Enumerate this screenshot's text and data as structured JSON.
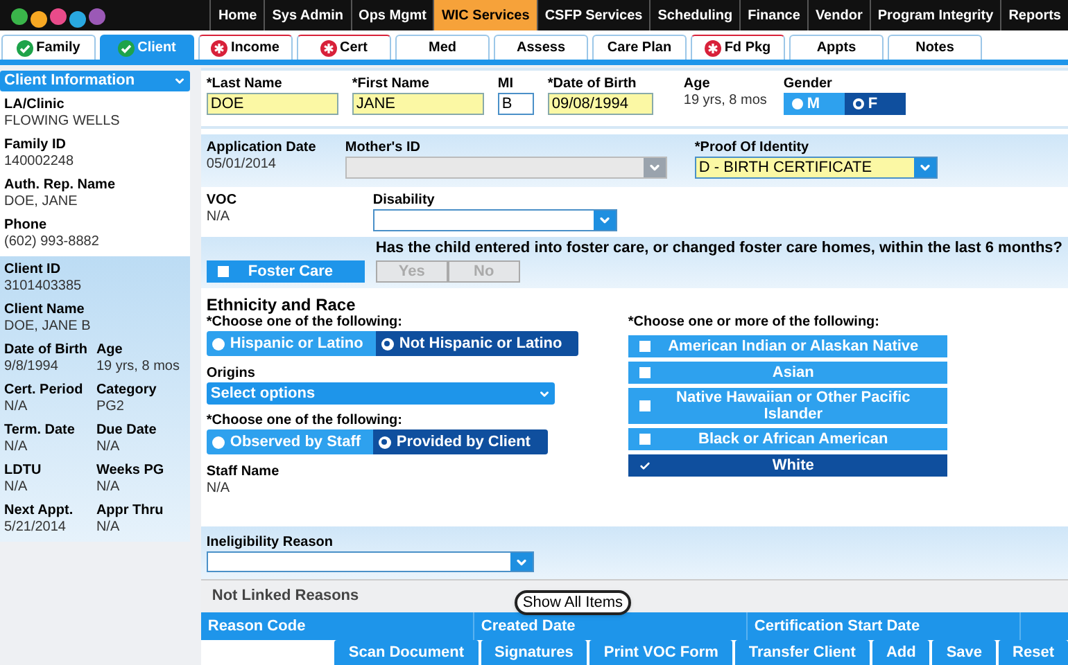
{
  "nav": [
    {
      "label": "Home",
      "selected": false
    },
    {
      "label": "Sys Admin",
      "selected": false
    },
    {
      "label": "Ops Mgmt",
      "selected": false
    },
    {
      "label": "WIC Services",
      "selected": true
    },
    {
      "label": "CSFP Services",
      "selected": false
    },
    {
      "label": "Scheduling",
      "selected": false
    },
    {
      "label": "Finance",
      "selected": false
    },
    {
      "label": "Vendor",
      "selected": false
    },
    {
      "label": "Program Integrity",
      "selected": false
    },
    {
      "label": "Reports",
      "selected": false
    }
  ],
  "tabs": [
    {
      "label": "Family",
      "kind": "complete",
      "selected": false
    },
    {
      "label": "Client",
      "kind": "complete",
      "selected": true
    },
    {
      "label": "Income",
      "kind": "required",
      "selected": false
    },
    {
      "label": "Cert",
      "kind": "required",
      "selected": false
    },
    {
      "label": "Med",
      "kind": "plain",
      "selected": false
    },
    {
      "label": "Assess",
      "kind": "plain",
      "selected": false
    },
    {
      "label": "Care Plan",
      "kind": "plain",
      "selected": false
    },
    {
      "label": "Fd Pkg",
      "kind": "required",
      "selected": false
    },
    {
      "label": "Appts",
      "kind": "plain",
      "selected": false
    },
    {
      "label": "Notes",
      "kind": "plain",
      "selected": false
    }
  ],
  "sidebar": {
    "title": "Client Information",
    "top_fields": [
      {
        "label": "LA/Clinic",
        "value": "FLOWING WELLS"
      },
      {
        "label": "Family ID",
        "value": "140002248"
      },
      {
        "label": "Auth. Rep. Name",
        "value": "DOE, JANE"
      },
      {
        "label": "Phone",
        "value": "(602) 993-8882"
      }
    ],
    "client_fields": [
      {
        "label": "Client ID",
        "value": "3101403385",
        "kind": "wide"
      },
      {
        "label": "Client Name",
        "value": "DOE, JANE B",
        "kind": "wide"
      },
      {
        "label": "Date of Birth",
        "value": "9/8/1994",
        "kind": "half"
      },
      {
        "label": "Age",
        "value": "19 yrs, 8 mos",
        "kind": "half"
      },
      {
        "label": "Cert. Period",
        "value": "N/A",
        "kind": "half"
      },
      {
        "label": "Category",
        "value": "PG2",
        "kind": "half"
      },
      {
        "label": "Term. Date",
        "value": "N/A",
        "kind": "half"
      },
      {
        "label": "Due Date",
        "value": "N/A",
        "kind": "half"
      },
      {
        "label": "LDTU",
        "value": "N/A",
        "kind": "half"
      },
      {
        "label": "Weeks PG",
        "value": "N/A",
        "kind": "half"
      },
      {
        "label": "Next Appt.",
        "value": "5/21/2014",
        "kind": "half"
      },
      {
        "label": "Appr Thru",
        "value": "N/A",
        "kind": "half"
      }
    ]
  },
  "name_row": {
    "last_name": {
      "label": "*Last Name",
      "value": "DOE"
    },
    "first_name": {
      "label": "*First Name",
      "value": "JANE"
    },
    "mi": {
      "label": "MI",
      "value": "B"
    },
    "date_of_birth": {
      "label": "*Date of Birth",
      "value": "09/08/1994"
    },
    "age": {
      "label": "Age",
      "value": "19 yrs, 8 mos"
    },
    "gender": {
      "label": "Gender",
      "options": [
        {
          "label": "M",
          "selected": false
        },
        {
          "label": "F",
          "selected": true
        }
      ]
    }
  },
  "application_date": {
    "label": "Application Date",
    "value": "05/01/2014"
  },
  "mothers_id": {
    "label": "Mother's ID",
    "disabled": true
  },
  "proof_of_identity": {
    "label": "*Proof Of Identity",
    "value": "D - BIRTH CERTIFICATE"
  },
  "voc": {
    "label": "VOC",
    "value": "N/A"
  },
  "disability": {
    "label": "Disability"
  },
  "foster_care": {
    "label": "Foster Care",
    "checked": false,
    "question": "Has the child entered into foster care, or changed foster care homes, within the last 6 months?",
    "options": [
      {
        "label": "Yes",
        "disabled": true
      },
      {
        "label": "No",
        "disabled": true
      }
    ]
  },
  "ethnicity": {
    "title": "Ethnicity and Race",
    "prompt": "*Choose one of the following:",
    "options": [
      {
        "label": "Hispanic or Latino",
        "selected": false
      },
      {
        "label": "Not Hispanic or Latino",
        "selected": true
      }
    ],
    "origins_label": "Origins",
    "origins_placeholder": "Select options",
    "source_prompt": "*Choose one of the following:",
    "source_options": [
      {
        "label": "Observed by Staff",
        "selected": false
      },
      {
        "label": "Provided by Client",
        "selected": true
      }
    ],
    "staff_name": {
      "label": "Staff Name",
      "value": "N/A"
    }
  },
  "race": {
    "prompt": "*Choose one or more of the following:",
    "options": [
      {
        "label": "American Indian or Alaskan Native",
        "checked": false
      },
      {
        "label": "Asian",
        "checked": false
      },
      {
        "label": "Native Hawaiian or Other Pacific Islander",
        "checked": false
      },
      {
        "label": "Black or African American",
        "checked": false
      },
      {
        "label": "White",
        "checked": true
      }
    ]
  },
  "ineligibility": {
    "label": "Ineligibility Reason"
  },
  "reasons_grid": {
    "title": "Not Linked Reasons",
    "tooltip": "Show All Items",
    "columns": [
      "Reason Code",
      "Created Date",
      "Certification Start Date"
    ]
  },
  "buttons": [
    "Scan Document",
    "Signatures",
    "Print VOC Form",
    "Transfer Client",
    "Add",
    "Save",
    "Reset"
  ]
}
